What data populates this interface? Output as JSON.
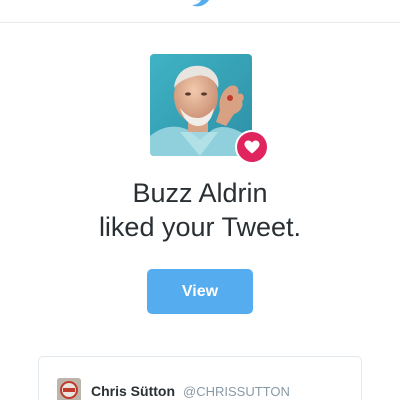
{
  "header": {
    "logo_icon": "twitter-bird-icon",
    "brand_color": "#55acee"
  },
  "notification": {
    "avatar_alt": "Buzz Aldrin profile photo",
    "badge_icon": "heart-icon",
    "badge_color": "#e0245e",
    "line1": "Buzz Aldrin",
    "line2": "liked your Tweet.",
    "view_label": "View",
    "button_color": "#55acee"
  },
  "tweet": {
    "author_name": "Chris Sütton",
    "author_handle": "@CHRISSUTTON"
  }
}
